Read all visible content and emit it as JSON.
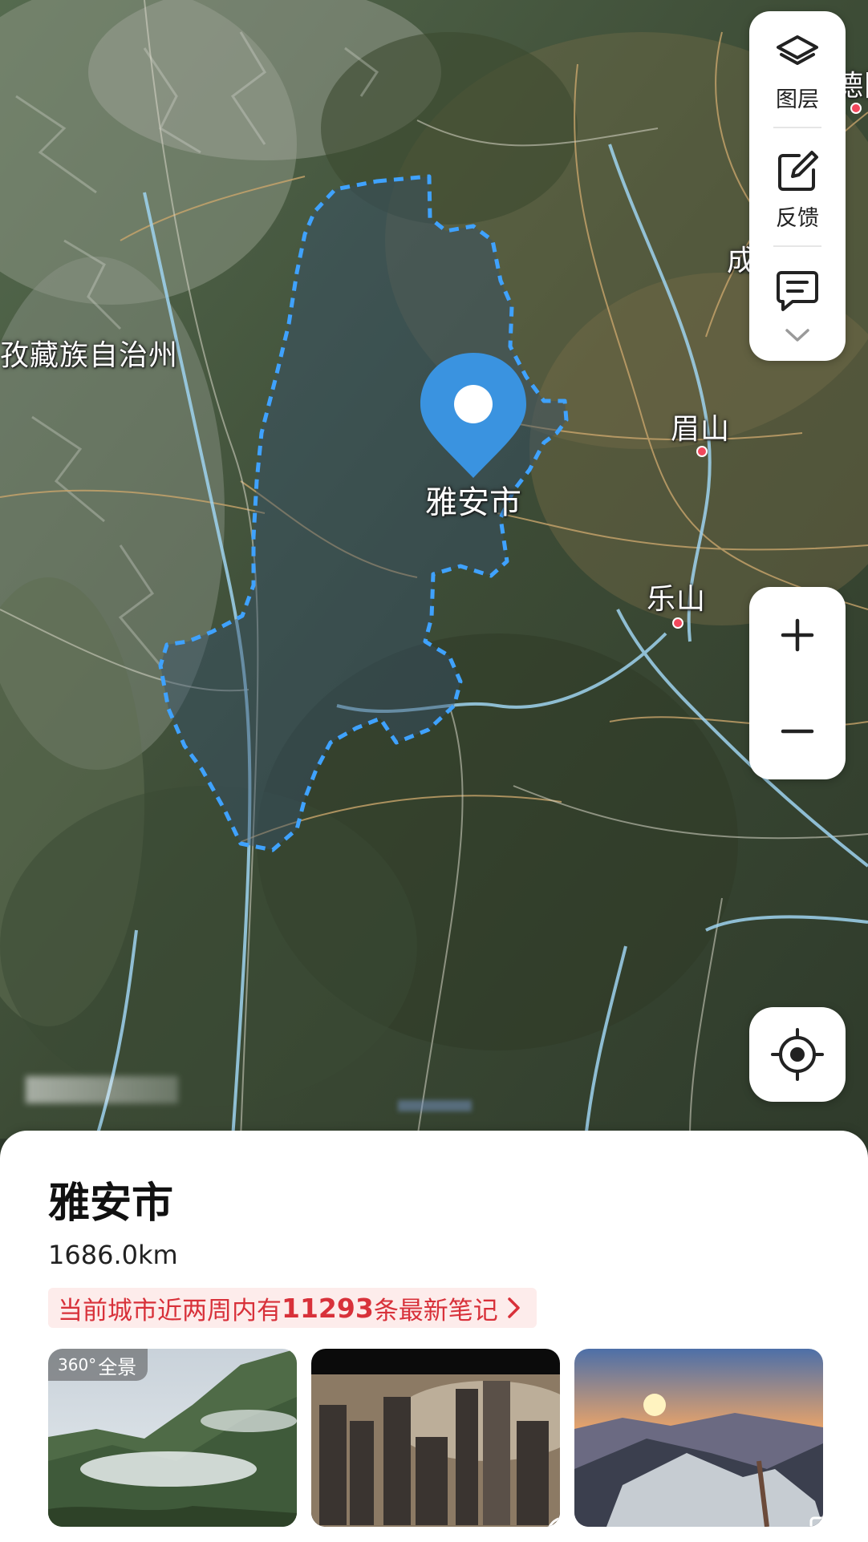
{
  "map": {
    "region_label": "孜藏族自治州",
    "cities": [
      {
        "name": "眉山"
      },
      {
        "name": "乐山"
      },
      {
        "name": "成"
      },
      {
        "name": "德阳"
      }
    ],
    "selected_city_label": "雅安市"
  },
  "toolbar": {
    "layers_label": "图层",
    "feedback_label": "反馈"
  },
  "icons": {
    "layers": "layers-icon",
    "feedback": "edit-square-icon",
    "message": "message-icon",
    "expand": "chevron-down-icon",
    "zoom_in": "plus-icon",
    "zoom_out": "minus-icon",
    "locate": "locate-target-icon",
    "pin": "location-pin-icon"
  },
  "colors": {
    "accent_blue": "#3a93e0",
    "boundary": "#3fa2ff",
    "banner_text": "#d8313a",
    "banner_bg": "#fdeceb"
  },
  "sheet": {
    "title": "雅安市",
    "distance": "1686.0km",
    "notes_prefix": "当前城市近两周内有",
    "notes_count": "11293",
    "notes_suffix": "条最新笔记",
    "thumbnails": [
      {
        "badge": "全景",
        "badge_num": "360°",
        "kind": "panorama"
      },
      {
        "kind": "video"
      },
      {
        "kind": "image"
      }
    ]
  }
}
